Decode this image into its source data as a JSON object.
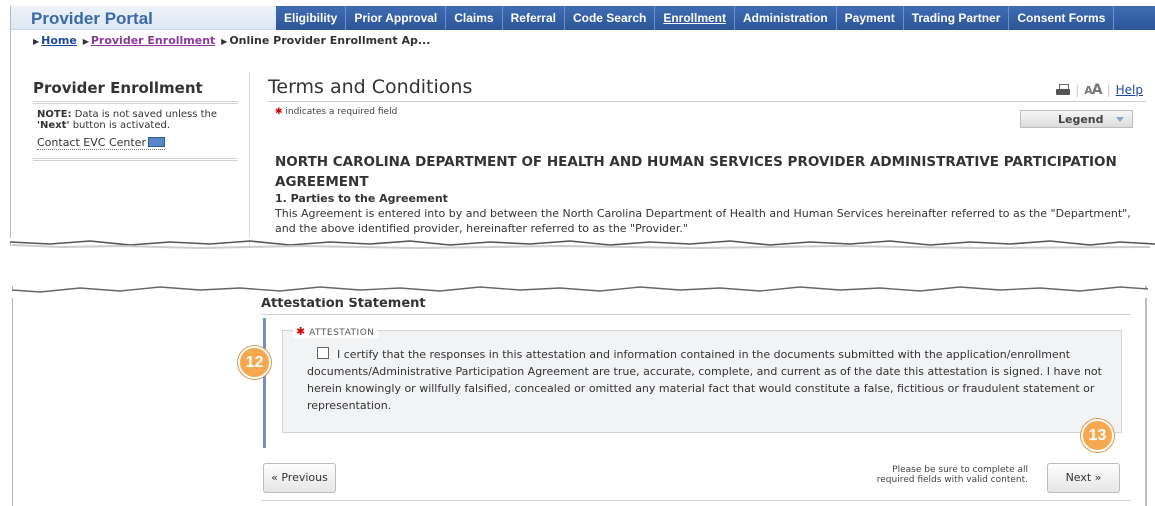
{
  "app": {
    "brand": "Provider Portal"
  },
  "nav": {
    "items": [
      {
        "label": "Eligibility",
        "active": false
      },
      {
        "label": "Prior Approval",
        "active": false
      },
      {
        "label": "Claims",
        "active": false
      },
      {
        "label": "Referral",
        "active": false
      },
      {
        "label": "Code Search",
        "active": false
      },
      {
        "label": "Enrollment",
        "active": true
      },
      {
        "label": "Administration",
        "active": false
      },
      {
        "label": "Payment",
        "active": false
      },
      {
        "label": "Trading Partner",
        "active": false
      },
      {
        "label": "Consent Forms",
        "active": false
      }
    ]
  },
  "breadcrumb": {
    "home": "Home",
    "provider_enrollment": "Provider Enrollment",
    "current": "Online Provider Enrollment Ap..."
  },
  "sidebar": {
    "title": "Provider Enrollment",
    "note_prefix": "NOTE:",
    "note_text": " Data is not saved unless the ",
    "note_bold": "'Next'",
    "note_suffix": " button is activated.",
    "contact_link": "Contact EVC Center"
  },
  "page": {
    "title": "Terms and Conditions",
    "help_link": "Help",
    "required_note": "indicates a required field",
    "legend_label": "Legend"
  },
  "agreement": {
    "title": "NORTH CAROLINA DEPARTMENT OF HEALTH AND HUMAN SERVICES PROVIDER ADMINISTRATIVE PARTICIPATION AGREEMENT",
    "section_heading": "1. Parties to the Agreement",
    "section_text": "This Agreement is entered into by and between the North Carolina Department of Health and Human Services hereinafter referred to as the \"Department\", and the above identified provider, hereinafter referred to as the \"Provider.\""
  },
  "attestation": {
    "section_title": "Attestation Statement",
    "legend": "ATTESTATION",
    "checked": false,
    "statement": "I certify that the responses in this attestation and information contained in the documents submitted with the application/enrollment documents/Administrative Participation Agreement are true, accurate, complete, and current as of the date this attestation is signed. I have not herein knowingly or willfully falsified, concealed or omitted any material fact that would constitute a false, fictitious or fraudulent statement or representation."
  },
  "footer": {
    "previous_label": "« Previous",
    "next_label": "Next »",
    "hint": "Please be sure to complete all required fields with valid content."
  },
  "callouts": {
    "first": "12",
    "second": "13"
  }
}
